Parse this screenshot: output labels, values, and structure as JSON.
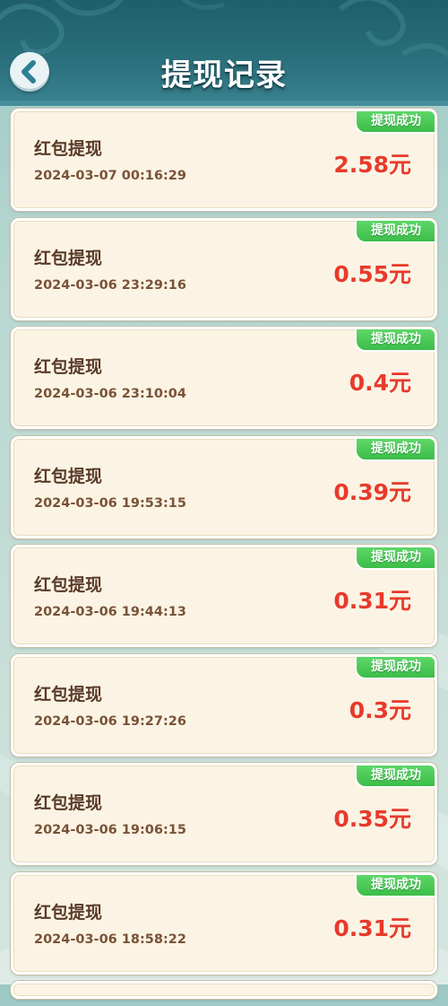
{
  "header": {
    "title": "提现记录",
    "back_icon": "chevron-left-icon"
  },
  "colors": {
    "header_bg": "#2a6f7b",
    "card_bg": "#fbf4e4",
    "amount": "#e83a2c",
    "badge_bg": "#3cbd48",
    "type_text": "#5a3a28",
    "time_text": "#7a5238"
  },
  "records": [
    {
      "type": "红包提现",
      "time": "2024-03-07 00:16:29",
      "amount": "2.58元",
      "status": "提现成功"
    },
    {
      "type": "红包提现",
      "time": "2024-03-06 23:29:16",
      "amount": "0.55元",
      "status": "提现成功"
    },
    {
      "type": "红包提现",
      "time": "2024-03-06 23:10:04",
      "amount": "0.4元",
      "status": "提现成功"
    },
    {
      "type": "红包提现",
      "time": "2024-03-06 19:53:15",
      "amount": "0.39元",
      "status": "提现成功"
    },
    {
      "type": "红包提现",
      "time": "2024-03-06 19:44:13",
      "amount": "0.31元",
      "status": "提现成功"
    },
    {
      "type": "红包提现",
      "time": "2024-03-06 19:27:26",
      "amount": "0.3元",
      "status": "提现成功"
    },
    {
      "type": "红包提现",
      "time": "2024-03-06 19:06:15",
      "amount": "0.35元",
      "status": "提现成功"
    },
    {
      "type": "红包提现",
      "time": "2024-03-06 18:58:22",
      "amount": "0.31元",
      "status": "提现成功"
    }
  ]
}
